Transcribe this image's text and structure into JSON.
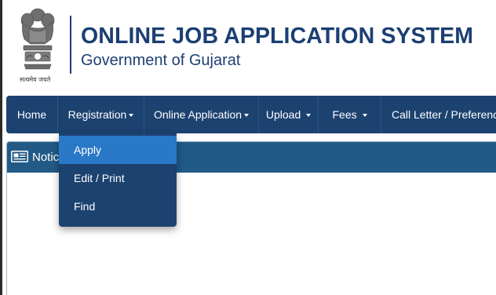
{
  "header": {
    "title": "ONLINE JOB APPLICATION SYSTEM",
    "subtitle": "Government of Gujarat",
    "emblem_caption": "सत्यमेव जयते",
    "emblem_icon": "state-emblem-icon"
  },
  "nav": {
    "items": [
      {
        "label": "Home"
      },
      {
        "label": "Registration",
        "has_caret": true
      },
      {
        "label": "Online Application",
        "has_caret": true
      },
      {
        "label": "Upload ",
        "has_caret": true
      },
      {
        "label": "Fees ",
        "has_caret": true
      },
      {
        "label": "Call Letter / Preferenc"
      }
    ]
  },
  "dropdown": {
    "open_menu": "Registration",
    "items": [
      {
        "label": "Apply",
        "active": true
      },
      {
        "label": "Edit / Print"
      },
      {
        "label": "Find"
      }
    ]
  },
  "notice": {
    "title": "Notic",
    "icon": "newspaper-icon"
  },
  "colors": {
    "brand": "#1c3f73",
    "navbar": "#1c4270",
    "panel_header": "#215a87",
    "active_item": "#2a78c8"
  }
}
